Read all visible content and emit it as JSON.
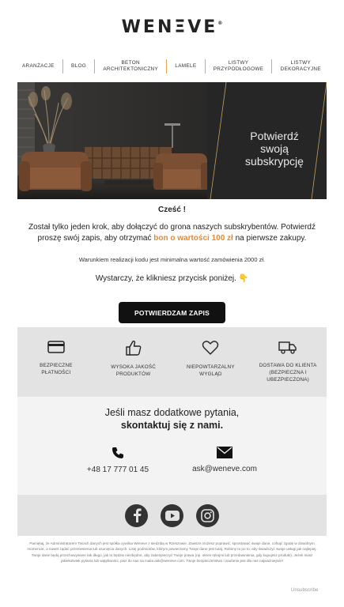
{
  "brand": {
    "logo_text": "WENΞVE",
    "trademark": "®"
  },
  "nav": {
    "items": [
      {
        "line1": "ARANŻACJE",
        "line2": ""
      },
      {
        "line1": "BLOG",
        "line2": ""
      },
      {
        "line1": "BETON",
        "line2": "ARCHITEKTONICZNY"
      },
      {
        "line1": "LAMELE",
        "line2": ""
      },
      {
        "line1": "LISTWY",
        "line2": "PRZYPODŁOGOWE"
      },
      {
        "line1": "LISTWY",
        "line2": "DEKORACYJNE"
      }
    ]
  },
  "hero": {
    "line1": "Potwierdź",
    "line2": "swoją subskrypcję"
  },
  "body": {
    "greeting": "Cześć !",
    "text1": "Został tylko jeden krok, aby dołączyć do grona naszych subskrybentów. Potwierdź proszę swój zapis, aby otrzymać ",
    "highlight": "bon o wartości 100 zł",
    "text2": " na pierwsze zakupy.",
    "note": "Warunkiem realizacji kodu jest minimalna wartość zamówienia 2000 zł.",
    "instruction": "Wystarczy, że klikniesz przycisk poniżej. 👇"
  },
  "cta": {
    "label": "POTWIERDZAM ZAPIS"
  },
  "features": [
    {
      "icon": "credit-card-icon",
      "line1": "BEZPIECZNE",
      "line2": "PŁATNOŚCI"
    },
    {
      "icon": "thumbs-up-icon",
      "line1": "WYSOKA JAKOŚĆ",
      "line2": "PRODUKTÓW"
    },
    {
      "icon": "heart-icon",
      "line1": "NIEPOWTARZALNY",
      "line2": "WYGLĄD"
    },
    {
      "icon": "truck-icon",
      "line1": "DOSTAWA DO KLIENTA",
      "line2": "(BEZPIECZNA I UBEZPIECZONA)"
    }
  ],
  "contact": {
    "question": "Jeśli masz dodatkowe pytania,",
    "question_bold": "skontaktuj się z nami.",
    "phone": "+48 17 777 01 45",
    "email": "ask@weneve.com"
  },
  "social": [
    "facebook-icon",
    "youtube-icon",
    "instagram-icon"
  ],
  "legal": "Pamiętaj, że Administratorem Twoich danych jest spółka cywilna Weneve z siedzibą w Rzeszowie. Zawsze możesz poprawić, sprostować swoje dane, cofnąć zgodę w dowolnym momencie, a nawet żądać przeniesienia lub usunięcia danych. Listę podmiotów, którym powierzamy Twoje dane jest tutaj. Robimy to po to, aby świadczyć swoje usługi jak najlepiej. Twoje dane będą przechowywane tak długo, jak to będzie niezbędne, aby zabezpieczyć Twoje prawa (np. okres rękojmi lub przedawnienia, gdy kupujesz produkt). Jeżeli masz jakiekolwiek pytania lub wątpliwości, pisz do nas na maila ask@weneve.com. Twoje bezpieczeństwo i zaufanie jest dla nas najważniejsze!",
  "footer": {
    "unsubscribe": "Unsubscribe"
  },
  "colors": {
    "accent": "#e9892a",
    "dark": "#111111",
    "gray_band": "#e3e3e3"
  }
}
